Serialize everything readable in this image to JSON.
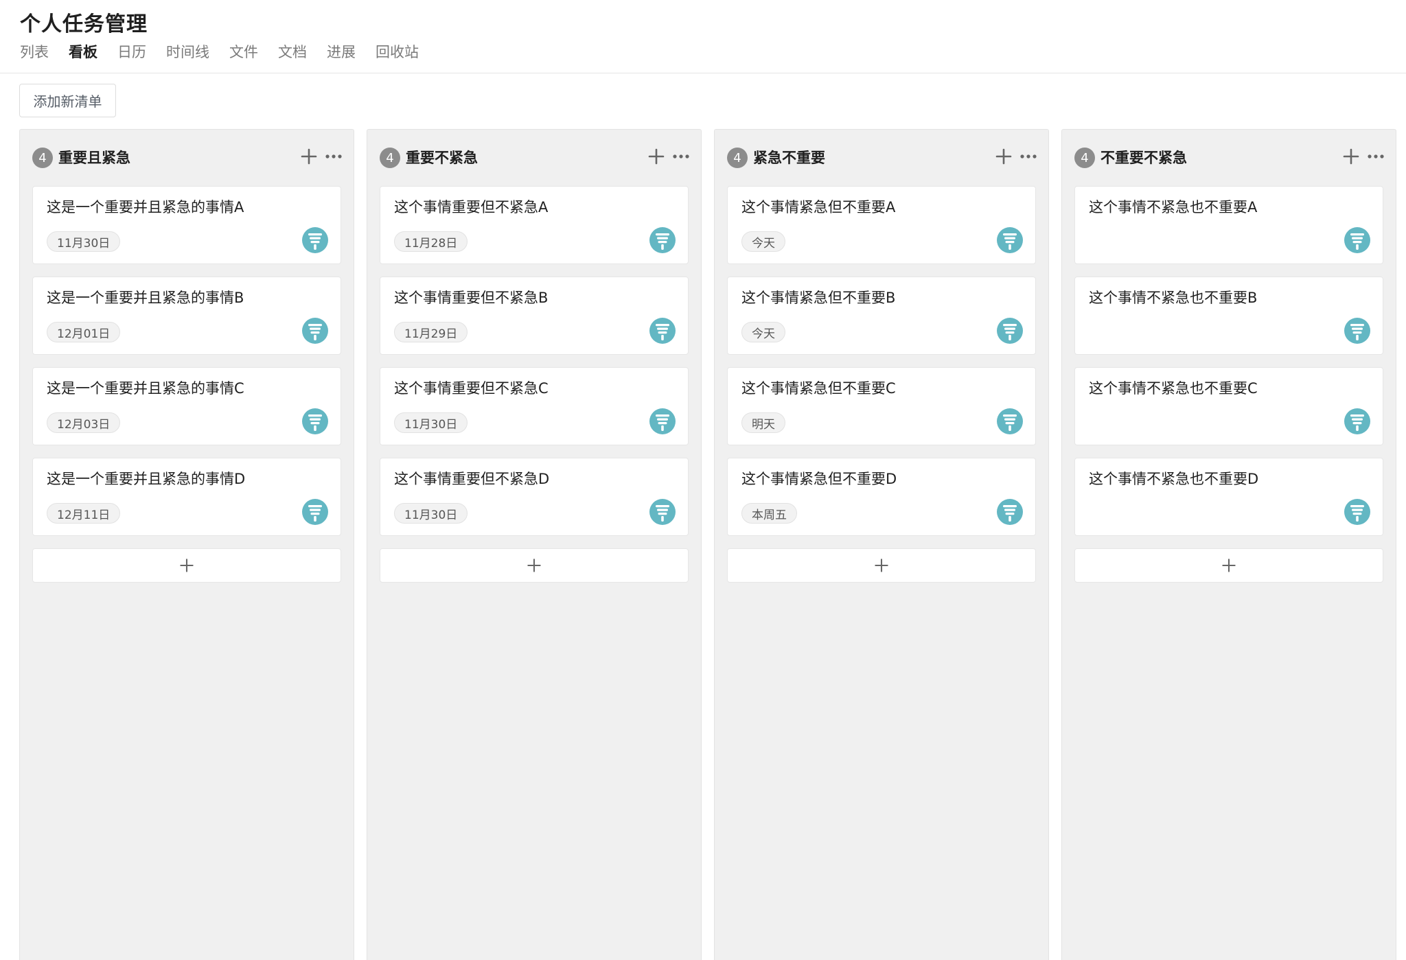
{
  "header": {
    "title": "个人任务管理",
    "tabs": [
      {
        "label": "列表",
        "active": false
      },
      {
        "label": "看板",
        "active": true
      },
      {
        "label": "日历",
        "active": false
      },
      {
        "label": "时间线",
        "active": false
      },
      {
        "label": "文件",
        "active": false
      },
      {
        "label": "文档",
        "active": false
      },
      {
        "label": "进展",
        "active": false
      },
      {
        "label": "回收站",
        "active": false
      }
    ]
  },
  "toolbar": {
    "add_list_label": "添加新清单"
  },
  "icons": {
    "column_add": "plus-icon",
    "column_more": "more-horizontal-icon",
    "card_avatar": "user-avatar-icon",
    "add_card": "plus-icon"
  },
  "colors": {
    "avatar": "#63b7c3",
    "badge": "#8c8c8c",
    "column_bg": "#f0f0f0"
  },
  "columns": [
    {
      "title": "重要且紧急",
      "count": "4",
      "cards": [
        {
          "title": "这是一个重要并且紧急的事情A",
          "due": "11月30日"
        },
        {
          "title": "这是一个重要并且紧急的事情B",
          "due": "12月01日"
        },
        {
          "title": "这是一个重要并且紧急的事情C",
          "due": "12月03日"
        },
        {
          "title": "这是一个重要并且紧急的事情D",
          "due": "12月11日"
        }
      ]
    },
    {
      "title": "重要不紧急",
      "count": "4",
      "cards": [
        {
          "title": "这个事情重要但不紧急A",
          "due": "11月28日"
        },
        {
          "title": "这个事情重要但不紧急B",
          "due": "11月29日"
        },
        {
          "title": "这个事情重要但不紧急C",
          "due": "11月30日"
        },
        {
          "title": "这个事情重要但不紧急D",
          "due": "11月30日"
        }
      ]
    },
    {
      "title": "紧急不重要",
      "count": "4",
      "cards": [
        {
          "title": "这个事情紧急但不重要A",
          "due": "今天"
        },
        {
          "title": "这个事情紧急但不重要B",
          "due": "今天"
        },
        {
          "title": "这个事情紧急但不重要C",
          "due": "明天"
        },
        {
          "title": "这个事情紧急但不重要D",
          "due": "本周五"
        }
      ]
    },
    {
      "title": "不重要不紧急",
      "count": "4",
      "cards": [
        {
          "title": "这个事情不紧急也不重要A",
          "due": ""
        },
        {
          "title": "这个事情不紧急也不重要B",
          "due": ""
        },
        {
          "title": "这个事情不紧急也不重要C",
          "due": ""
        },
        {
          "title": "这个事情不紧急也不重要D",
          "due": ""
        }
      ]
    }
  ]
}
